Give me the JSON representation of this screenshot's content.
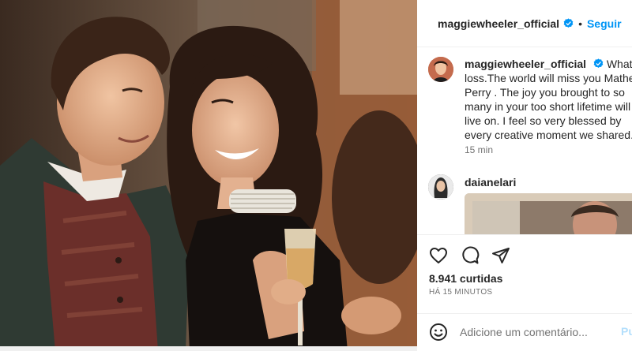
{
  "header": {
    "username": "maggiewheeler_official",
    "separator": "•",
    "follow_label": "Seguir"
  },
  "caption": {
    "username": "maggiewheeler_official",
    "text": "What a loss.The world will miss you Mathew Perry . The joy you brought to so many in your too short lifetime will live on. I feel so very blessed by every creative moment we shared. ♥",
    "time": "15 min"
  },
  "comment": {
    "username": "daianelari"
  },
  "actions": {
    "likes": "8.941 curtidas",
    "time": "HÁ 15 MINUTOS"
  },
  "add_comment": {
    "placeholder": "Adicione um comentário...",
    "publish_label": "Publicar"
  },
  "colors": {
    "accent": "#0095f6",
    "text": "#262626",
    "secondary_text": "#737373"
  },
  "icons": [
    "verified-badge-icon",
    "heart-icon",
    "comment-icon",
    "share-icon",
    "emoji-icon"
  ]
}
